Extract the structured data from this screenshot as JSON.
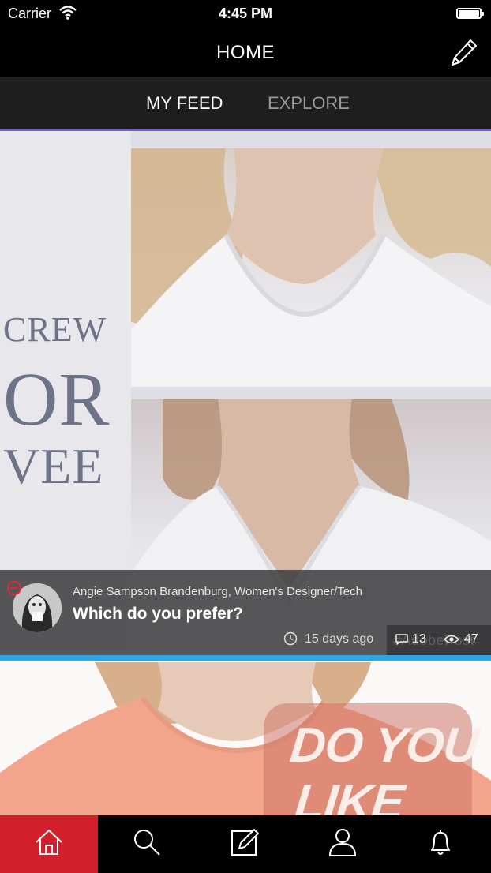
{
  "status_bar": {
    "carrier": "Carrier",
    "time": "4:45 PM"
  },
  "header": {
    "title": "HOME",
    "compose_icon": "pencil-icon"
  },
  "tabs": [
    {
      "label": "MY FEED",
      "active": true
    },
    {
      "label": "EXPLORE",
      "active": false
    }
  ],
  "feed": {
    "posts": [
      {
        "overlay_text": [
          "CREW",
          "OR",
          "VEE"
        ],
        "author": "Angie Sampson Brandenburg, Women's Designer/Tech",
        "question": "Which do you prefer?",
        "time_ago": "15 days ago",
        "comments": "13",
        "views": "47",
        "watermark": "#AdobePost"
      },
      {
        "overlay_text": [
          "DO YOU",
          "LIKE THIS"
        ]
      }
    ]
  },
  "tab_bar": {
    "items": [
      {
        "icon": "home-icon",
        "active": true
      },
      {
        "icon": "search-icon",
        "active": false
      },
      {
        "icon": "compose-icon",
        "active": false
      },
      {
        "icon": "profile-icon",
        "active": false
      },
      {
        "icon": "bell-icon",
        "active": false
      }
    ]
  },
  "colors": {
    "tab_underline": "#7b5bc4",
    "post_divider": "#2fa3e6",
    "active_tab_bg": "#d21f2c"
  }
}
